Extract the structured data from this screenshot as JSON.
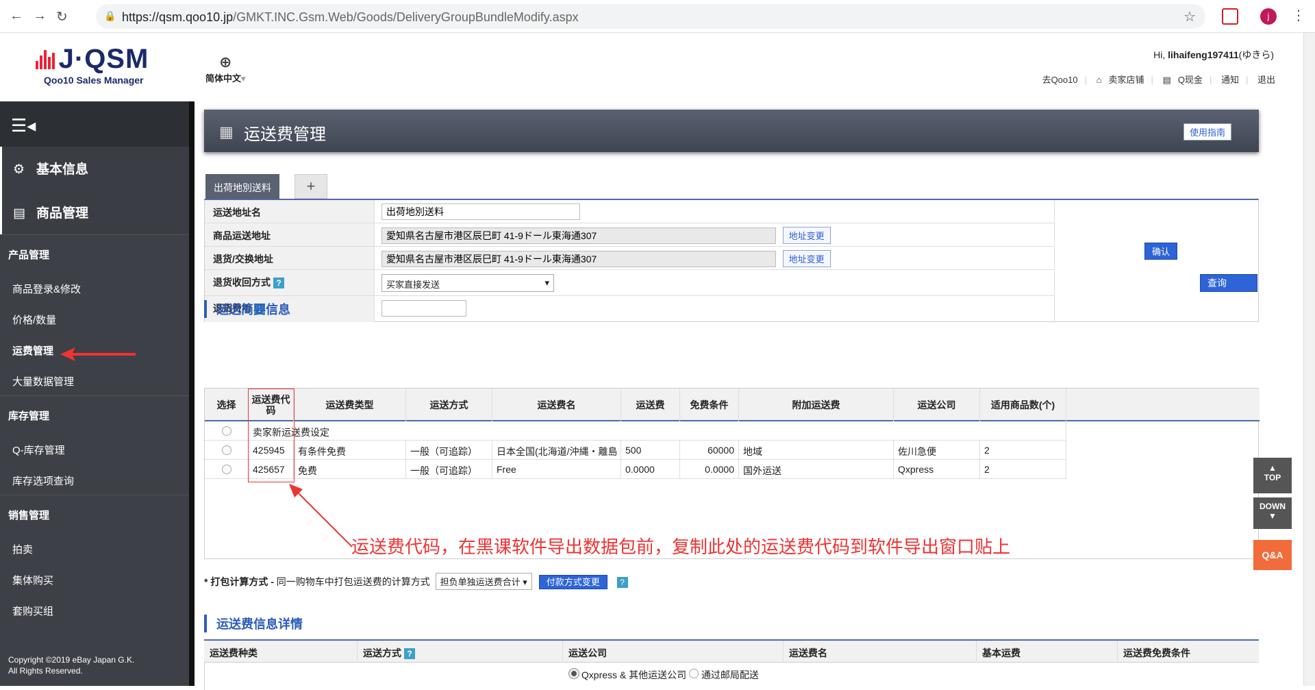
{
  "browser": {
    "url_host": "https://qsm.qoo10.jp",
    "url_path": "/GMKT.INC.Gsm.Web/Goods/DeliveryGroupBundleModify.aspx",
    "profile_initial": "j"
  },
  "header": {
    "logo_title": "J·QSM",
    "logo_sub": "Qoo10 Sales Manager",
    "language": "简体中文",
    "greeting_prefix": "Hi,",
    "username": "lihaifeng197411",
    "username_suffix": "(ゆきら)",
    "menu": [
      "去Qoo10",
      "卖家店铺",
      "Q现金",
      "通知",
      "退出"
    ]
  },
  "sidebar": {
    "big_items": [
      "基本信息",
      "商品管理"
    ],
    "groups": [
      {
        "title": "产品管理",
        "items": [
          "商品登录&修改",
          "价格/数量",
          "运费管理",
          "大量数据管理"
        ]
      },
      {
        "title": "库存管理",
        "items": [
          "Q-库存管理",
          "库存选项查询"
        ]
      },
      {
        "title": "销售管理",
        "items": [
          "拍卖",
          "集体购买",
          "套购买组"
        ]
      }
    ],
    "copyright_line1": "Copyright ©2019 eBay Japan G.K.",
    "copyright_line2": "All Rights Reserved."
  },
  "page": {
    "title": "运送费管理",
    "guide_button": "使用指南",
    "tab_active": "出荷地別送料",
    "tab_add": "+"
  },
  "form": {
    "rows": [
      {
        "label": "运送地址名",
        "value": "出荷地別送料",
        "help": false
      },
      {
        "label": "商品运送地址",
        "value": "愛知県名古屋市港区辰巳町 41-9ドール東海通307",
        "button": "地址变更",
        "help": false
      },
      {
        "label": "退货/交换地址",
        "value": "愛知県名古屋市港区辰巳町 41-9ドール東海通307",
        "button": "地址变更",
        "help": false
      },
      {
        "label": "退货收回方式",
        "value": "买家直接发送",
        "help": true
      },
      {
        "label": "退货费用",
        "value": "",
        "help": true
      }
    ],
    "confirm_button": "确认",
    "search_button": "查询"
  },
  "summary": {
    "title": "运送简要信息",
    "columns": [
      "选择",
      "运送费代码",
      "运送费类型",
      "运送方式",
      "运送费名",
      "运送费",
      "免费条件",
      "附加运送费",
      "运送公司",
      "适用商品数(个)"
    ],
    "new_row_label": "卖家新运送费设定",
    "rows": [
      {
        "code": "425945",
        "type": "有条件免费",
        "method": "一般（可追踪）",
        "name": "日本全国(北海道/沖縄・離島",
        "fee": "500",
        "free": "60000",
        "extra": "地域",
        "company": "佐川急便",
        "count": "2"
      },
      {
        "code": "425657",
        "type": "免费",
        "method": "一般（可追踪）",
        "name": "Free",
        "fee": "0.0000",
        "free": "0.0000",
        "extra": "国外运送",
        "company": "Qxpress",
        "count": "2"
      }
    ],
    "annotation": "运送费代码，在黑课软件导出数据包前，复制此处的运送费代码到软件导出窗口贴上"
  },
  "packing": {
    "label": "* 打包计算方式 -",
    "desc": "同一购物车中打包运送费的计算方式",
    "select_value": "担负单独运送费合计",
    "button": "付款方式变更"
  },
  "detail": {
    "title": "运送费信息详情",
    "columns": [
      "运送费种类",
      "运送方式",
      "运送公司",
      "运送费名",
      "基本运费",
      "运送费免费条件"
    ],
    "carrier_option1": "Qxpress & 其他运送公司",
    "carrier_option2": "通过邮局配送"
  },
  "float": {
    "top": "TOP",
    "down": "DOWN",
    "qa": "Q&A"
  },
  "colors": {
    "accent": "#2c5db9",
    "annotation": "#e33333",
    "qa": "#f26b3a",
    "sidebar": "#3d4047"
  }
}
